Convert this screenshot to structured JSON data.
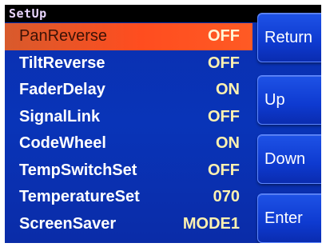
{
  "window": {
    "title": "SetUp"
  },
  "menu": {
    "items": [
      {
        "label": "PanReverse",
        "value": "OFF"
      },
      {
        "label": "TiltReverse",
        "value": "OFF"
      },
      {
        "label": "FaderDelay",
        "value": "ON"
      },
      {
        "label": "SignalLink",
        "value": "OFF"
      },
      {
        "label": "CodeWheel",
        "value": "ON"
      },
      {
        "label": "TempSwitchSet",
        "value": "OFF"
      },
      {
        "label": "TemperatureSet",
        "value": "070"
      },
      {
        "label": "ScreenSaver",
        "value": "MODE1"
      }
    ]
  },
  "buttons": {
    "return_label": "Return",
    "up_label": "Up",
    "down_label": "Down",
    "enter_label": "Enter"
  },
  "colors": {
    "background": "#0a2fb0",
    "selected_row": "#ff4d1f",
    "value_text": "#fff2b0",
    "title_text": "#e9d6ff"
  }
}
